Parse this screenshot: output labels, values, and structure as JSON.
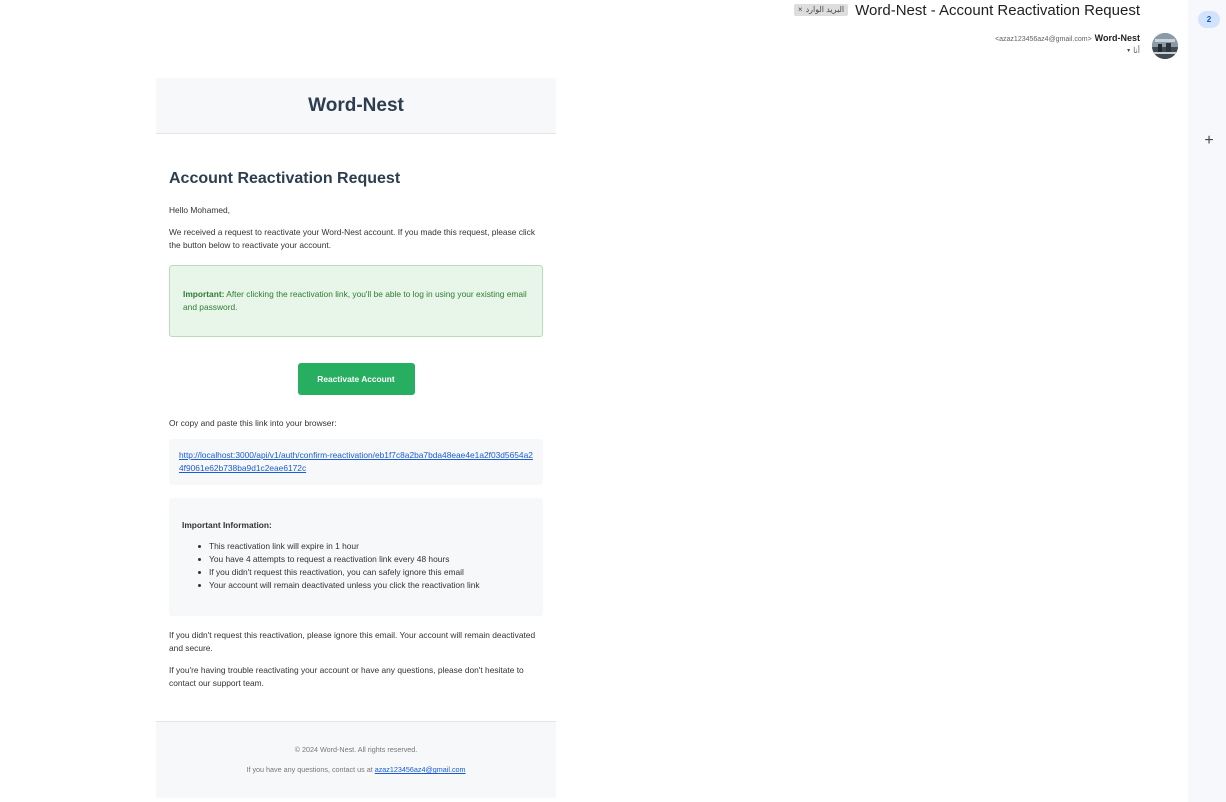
{
  "header": {
    "subject": "Word-Nest - Account Reactivation Request",
    "label": "البريد الوارد",
    "label_close": "×",
    "sender_name": "Word-Nest",
    "sender_email": "<azaz123456az4@gmail.com>",
    "to": "أنا",
    "to_caret": "▾"
  },
  "side_panel": {
    "badge": "2",
    "add": "+"
  },
  "email": {
    "brand": "Word-Nest",
    "heading": "Account Reactivation Request",
    "greeting": "Hello Mohamed,",
    "intro": "We received a request to reactivate your Word-Nest account. If you made this request, please click the button below to reactivate your account.",
    "notice_label": "Important:",
    "notice_text": " After clicking the reactivation link, you'll be able to log in using your existing email and password.",
    "button_label": "Reactivate Account",
    "copy_label": "Or copy and paste this link into your browser:",
    "link": "http://localhost:3000/api/v1/auth/confirm-reactivation/eb1f7c8a2ba7bda48eae4e1a2f03d5654a24f9061e62b738ba9d1c2eae6172c",
    "info_title": "Important Information:",
    "info_items": [
      "This reactivation link will expire in 1 hour",
      "You have 4 attempts to request a reactivation link every 48 hours",
      "If you didn't request this reactivation, you can safely ignore this email",
      "Your account will remain deactivated unless you click the reactivation link"
    ],
    "para_ignore": "If you didn't request this reactivation, please ignore this email. Your account will remain deactivated and secure.",
    "para_support": "If you're having trouble reactivating your account or have any questions, please don't hesitate to contact our support team.",
    "footer_copyright": "© 2024 Word-Nest. All rights reserved.",
    "footer_contact": "If you have any questions, contact us at ",
    "footer_email": "azaz123456az4@gmail.com"
  }
}
